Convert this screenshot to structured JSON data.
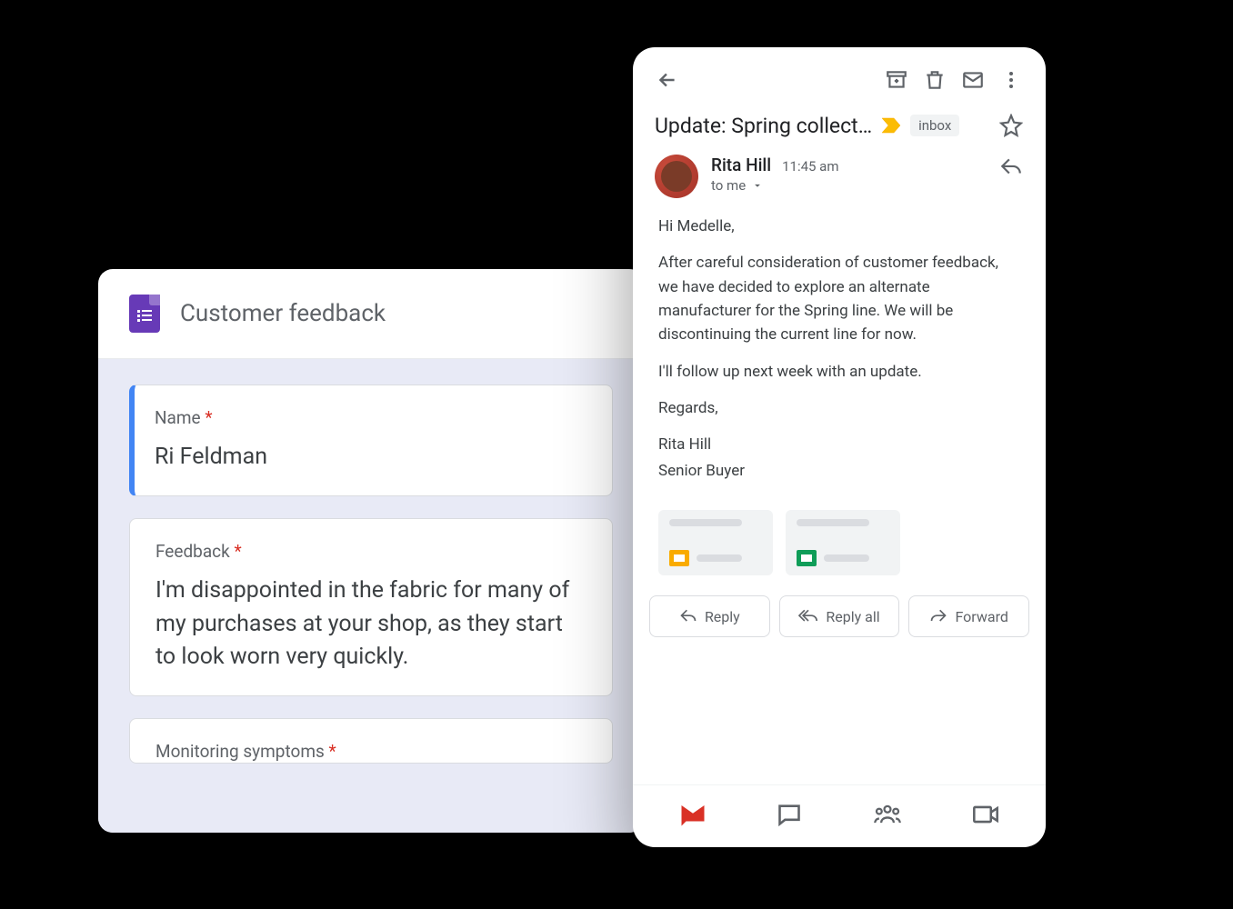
{
  "forms": {
    "title": "Customer feedback",
    "questions": [
      {
        "label": "Name",
        "required": true,
        "answer": "Ri Feldman"
      },
      {
        "label": "Feedback",
        "required": true,
        "answer": "I'm disappointed in the fabric for many of my purchases at your shop, as they start to look worn very quickly."
      },
      {
        "label": "Monitoring symptoms",
        "required": true,
        "answer": ""
      }
    ]
  },
  "gmail": {
    "subject": "Update: Spring collect…",
    "inbox_chip": "inbox",
    "sender": {
      "name": "Rita Hill",
      "time": "11:45 am",
      "to": "to me"
    },
    "body": {
      "greeting": "Hi Medelle,",
      "p1": "After careful consideration of customer feedback, we have decided to explore an alternate manufacturer for the Spring line. We will be discontinuing the current line for now.",
      "p2": "I'll follow up next week with an update.",
      "regards": "Regards,",
      "sig_name": "Rita Hill",
      "sig_title": "Senior Buyer"
    },
    "actions": {
      "reply": "Reply",
      "reply_all": "Reply all",
      "forward": "Forward"
    }
  }
}
